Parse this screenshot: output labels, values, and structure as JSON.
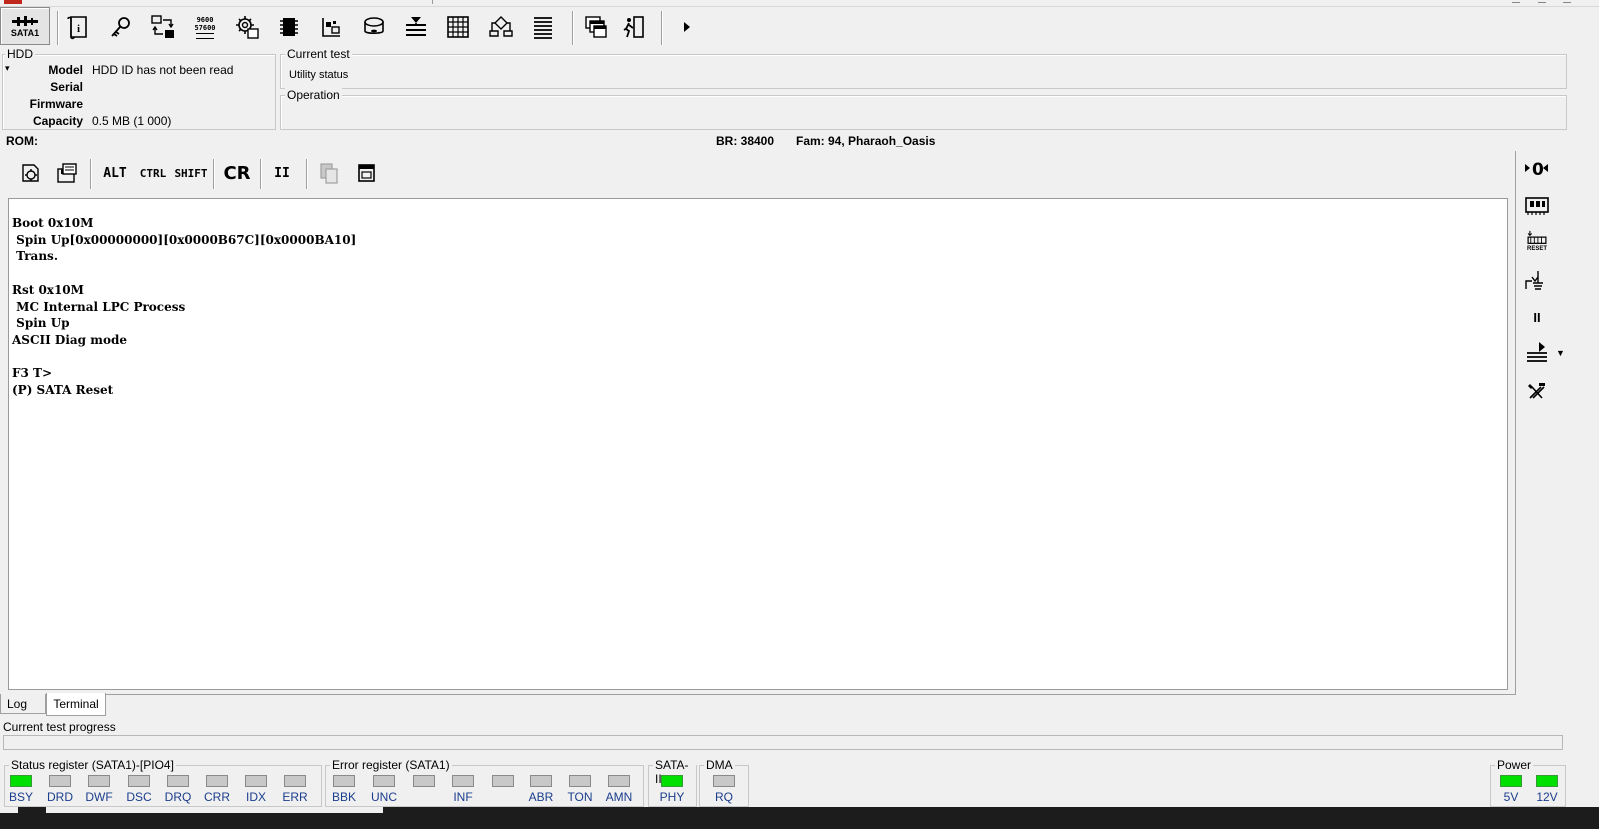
{
  "toolbar": {
    "sata_label": "SATA1",
    "speed_top": "9600",
    "speed_bottom": "57600"
  },
  "hdd": {
    "title": "HDD",
    "fields": [
      {
        "label": "Model",
        "value": "HDD ID has not been read"
      },
      {
        "label": "Serial",
        "value": ""
      },
      {
        "label": "Firmware",
        "value": ""
      },
      {
        "label": "Capacity",
        "value": "0.5 MB (1 000)"
      }
    ]
  },
  "current_test": {
    "title": "Current test",
    "value": "Utility status"
  },
  "operation": {
    "title": "Operation",
    "value": ""
  },
  "status_line": {
    "rom": "ROM:",
    "br": "BR: 38400",
    "fam": "Fam: 94, Pharaoh_Oasis"
  },
  "term_toolbar": {
    "alt": "ALT",
    "ctrl": "CTRL",
    "shift": "SHIFT",
    "cr": "CR",
    "pause": "II"
  },
  "terminal": {
    "lines": [
      "Boot 0x10M",
      " Spin Up[0x00000000][0x0000B67C][0x0000BA10]",
      " Trans.",
      "",
      "Rst 0x10M",
      " MC Internal LPC Process",
      " Spin Up",
      "ASCII Diag mode",
      "",
      "F3 T>",
      "(P) SATA Reset"
    ]
  },
  "side_toolbar": {
    "reset_label": "RESET",
    "pause": "II"
  },
  "tabs": [
    {
      "label": "Log",
      "active": false
    },
    {
      "label": "Terminal",
      "active": true
    }
  ],
  "progress": {
    "label": "Current test progress",
    "percent": 0
  },
  "status_register": {
    "title": "Status register (SATA1)-[PIO4]",
    "leds": [
      {
        "label": "BSY",
        "on": true
      },
      {
        "label": "DRD",
        "on": false
      },
      {
        "label": "DWF",
        "on": false
      },
      {
        "label": "DSC",
        "on": false
      },
      {
        "label": "DRQ",
        "on": false
      },
      {
        "label": "CRR",
        "on": false
      },
      {
        "label": "IDX",
        "on": false
      },
      {
        "label": "ERR",
        "on": false
      }
    ]
  },
  "error_register": {
    "title": "Error register (SATA1)",
    "leds": [
      {
        "label": "BBK",
        "on": false
      },
      {
        "label": "UNC",
        "on": false
      },
      {
        "label": "",
        "on": false
      },
      {
        "label": "INF",
        "on": false
      },
      {
        "label": "",
        "on": false
      },
      {
        "label": "ABR",
        "on": false
      },
      {
        "label": "TON",
        "on": false
      },
      {
        "label": "AMN",
        "on": false
      }
    ]
  },
  "sata2": {
    "title": "SATA-II",
    "leds": [
      {
        "label": "PHY",
        "on": true
      }
    ]
  },
  "dma": {
    "title": "DMA",
    "leds": [
      {
        "label": "RQ",
        "on": false
      }
    ]
  },
  "power": {
    "title": "Power",
    "leds": [
      {
        "label": "5V",
        "on": true
      },
      {
        "label": "12V",
        "on": true
      }
    ]
  },
  "colors": {
    "led_on": "#00e000",
    "led_off": "#c8c8c8",
    "led_label": "#1a3d8c",
    "progress": "#06b025"
  }
}
